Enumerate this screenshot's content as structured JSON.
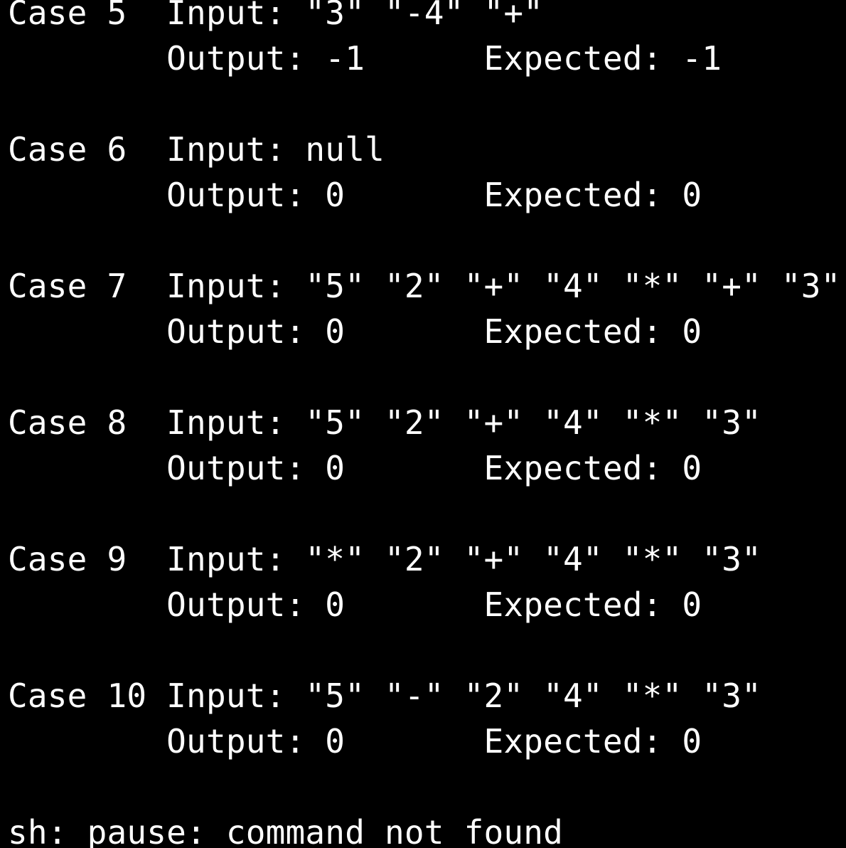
{
  "terminal": {
    "background": "#000000",
    "foreground": "#ffffff",
    "lines": [
      "Case 5  Input: \"3\" \"-4\" \"+\"",
      "        Output: -1      Expected: -1",
      "",
      "Case 6  Input: null",
      "        Output: 0       Expected: 0",
      "",
      "Case 7  Input: \"5\" \"2\" \"+\" \"4\" \"*\" \"+\" \"3\"",
      "        Output: 0       Expected: 0",
      "",
      "Case 8  Input: \"5\" \"2\" \"+\" \"4\" \"*\" \"3\"",
      "        Output: 0       Expected: 0",
      "",
      "Case 9  Input: \"*\" \"2\" \"+\" \"4\" \"*\" \"3\"",
      "        Output: 0       Expected: 0",
      "",
      "Case 10 Input: \"5\" \"-\" \"2\" \"4\" \"*\" \"3\"",
      "        Output: 0       Expected: 0",
      "",
      "sh: pause: command not found"
    ]
  }
}
